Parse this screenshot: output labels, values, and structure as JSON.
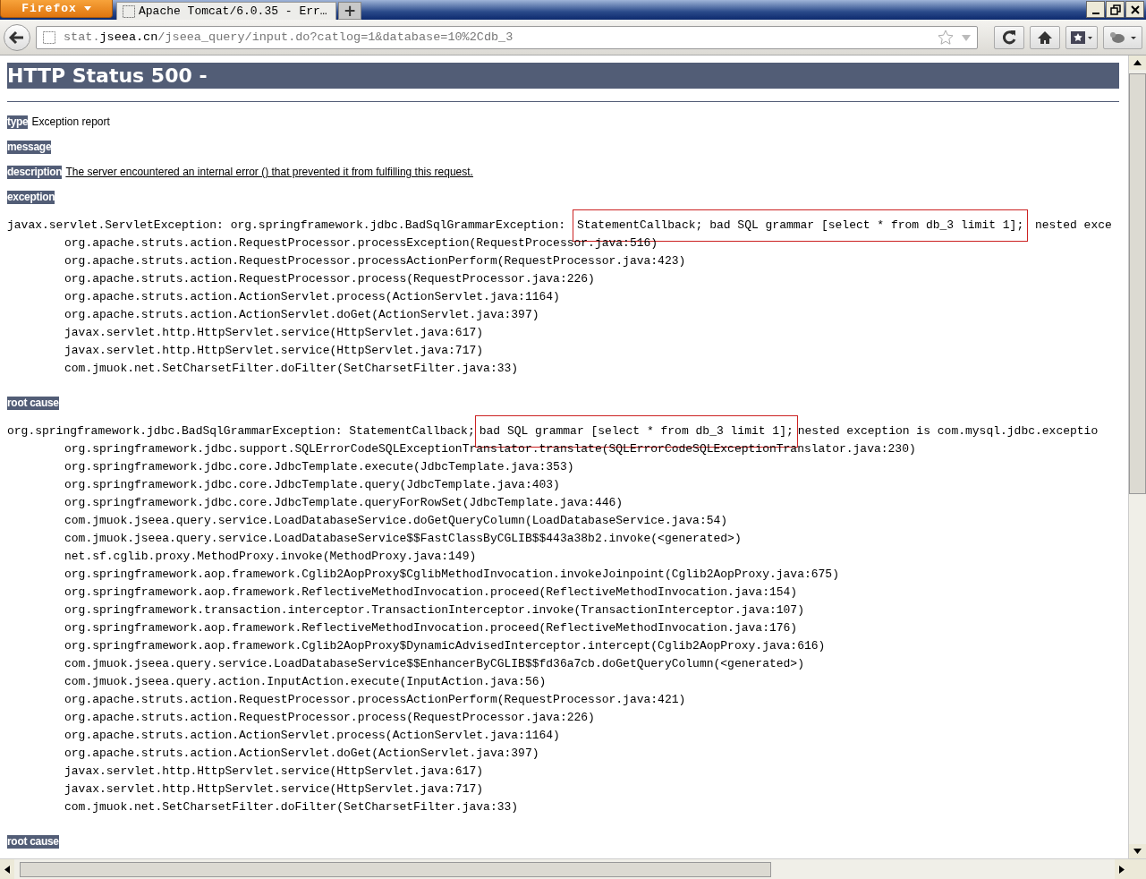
{
  "window": {
    "app_button": "Firefox",
    "tabs": [
      {
        "title": "Apache Tomcat/6.0.35 - Err…",
        "selected": true
      }
    ],
    "new_tab": "+"
  },
  "toolbar": {
    "url": {
      "subdomain": "stat.",
      "domain": "jseea.cn",
      "path": "/jseea_query/input.do?catlog=1&database=10%2Cdb_3"
    }
  },
  "page": {
    "heading": "HTTP Status 500 -",
    "fields": [
      {
        "label": "type",
        "value": "Exception report",
        "underlined": false
      },
      {
        "label": "message"
      },
      {
        "label": "description",
        "value": "The server encountered an internal error () that prevented it from fulfilling this request.",
        "underlined": true
      },
      {
        "label": "exception"
      }
    ],
    "exception": {
      "before": "javax.servlet.ServletException: org.springframework.jdbc.BadSqlGrammarException: ",
      "highlight": "StatementCallback; bad SQL grammar [select * from db_3 limit 1];",
      "after": " nested exce",
      "frames": [
        "org.apache.struts.action.RequestProcessor.processException(RequestProcessor.java:516)",
        "org.apache.struts.action.RequestProcessor.processActionPerform(RequestProcessor.java:423)",
        "org.apache.struts.action.RequestProcessor.process(RequestProcessor.java:226)",
        "org.apache.struts.action.ActionServlet.process(ActionServlet.java:1164)",
        "org.apache.struts.action.ActionServlet.doGet(ActionServlet.java:397)",
        "javax.servlet.http.HttpServlet.service(HttpServlet.java:617)",
        "javax.servlet.http.HttpServlet.service(HttpServlet.java:717)",
        "com.jmuok.net.SetCharsetFilter.doFilter(SetCharsetFilter.java:33)"
      ]
    },
    "root_cause_label": "root cause",
    "root_cause": {
      "before": "org.springframework.jdbc.BadSqlGrammarException: StatementCallback;",
      "highlight": "bad SQL grammar [select * from db_3 limit 1];",
      "after": "nested exception is com.mysql.jdbc.exceptio",
      "frames": [
        "org.springframework.jdbc.support.SQLErrorCodeSQLExceptionTranslator.translate(SQLErrorCodeSQLExceptionTranslator.java:230)",
        "org.springframework.jdbc.core.JdbcTemplate.execute(JdbcTemplate.java:353)",
        "org.springframework.jdbc.core.JdbcTemplate.query(JdbcTemplate.java:403)",
        "org.springframework.jdbc.core.JdbcTemplate.queryForRowSet(JdbcTemplate.java:446)",
        "com.jmuok.jseea.query.service.LoadDatabaseService.doGetQueryColumn(LoadDatabaseService.java:54)",
        "com.jmuok.jseea.query.service.LoadDatabaseService$$FastClassByCGLIB$$443a38b2.invoke(<generated>)",
        "net.sf.cglib.proxy.MethodProxy.invoke(MethodProxy.java:149)",
        "org.springframework.aop.framework.Cglib2AopProxy$CglibMethodInvocation.invokeJoinpoint(Cglib2AopProxy.java:675)",
        "org.springframework.aop.framework.ReflectiveMethodInvocation.proceed(ReflectiveMethodInvocation.java:154)",
        "org.springframework.transaction.interceptor.TransactionInterceptor.invoke(TransactionInterceptor.java:107)",
        "org.springframework.aop.framework.ReflectiveMethodInvocation.proceed(ReflectiveMethodInvocation.java:176)",
        "org.springframework.aop.framework.Cglib2AopProxy$DynamicAdvisedInterceptor.intercept(Cglib2AopProxy.java:616)",
        "com.jmuok.jseea.query.service.LoadDatabaseService$$EnhancerByCGLIB$$fd36a7cb.doGetQueryColumn(<generated>)",
        "com.jmuok.jseea.query.action.InputAction.execute(InputAction.java:56)",
        "org.apache.struts.action.RequestProcessor.processActionPerform(RequestProcessor.java:421)",
        "org.apache.struts.action.RequestProcessor.process(RequestProcessor.java:226)",
        "org.apache.struts.action.ActionServlet.process(ActionServlet.java:1164)",
        "org.apache.struts.action.ActionServlet.doGet(ActionServlet.java:397)",
        "javax.servlet.http.HttpServlet.service(HttpServlet.java:617)",
        "javax.servlet.http.HttpServlet.service(HttpServlet.java:717)",
        "com.jmuok.net.SetCharsetFilter.doFilter(SetCharsetFilter.java:33)"
      ]
    },
    "root_cause_label_2": "root cause"
  }
}
